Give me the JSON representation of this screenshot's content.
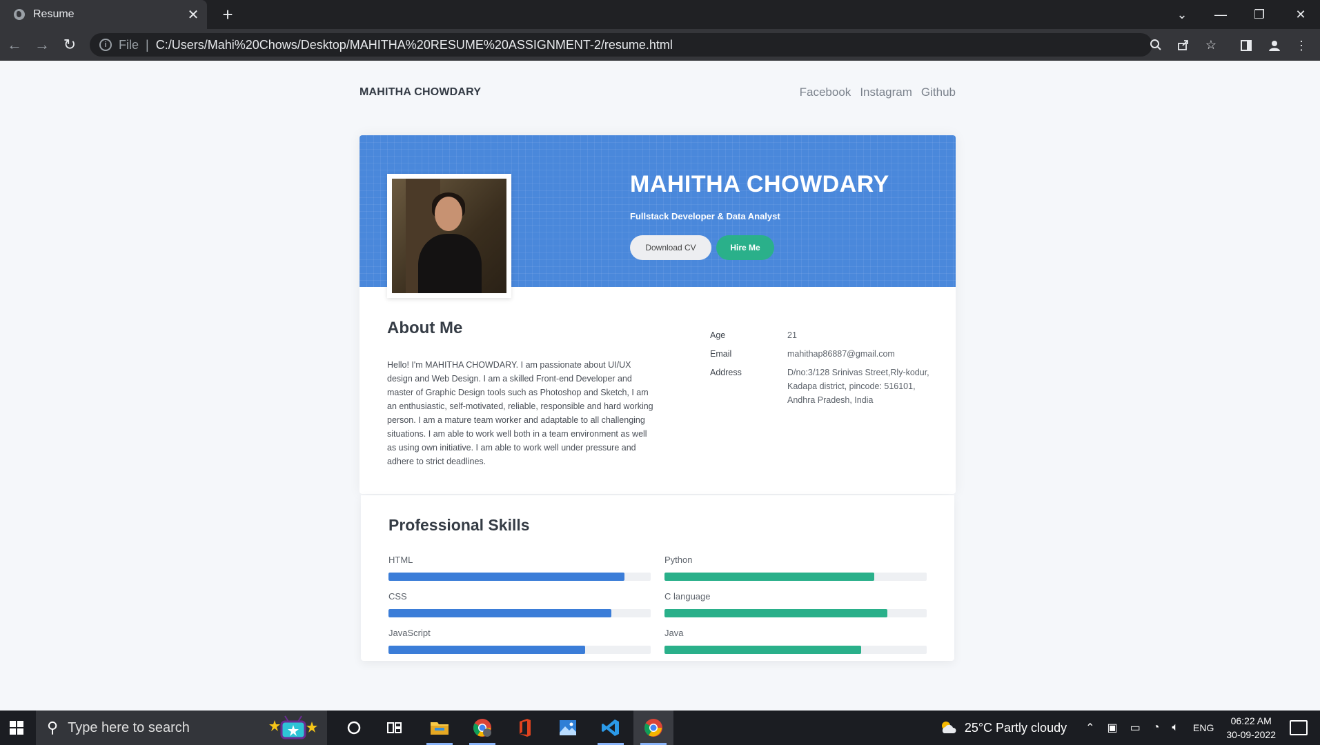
{
  "browser": {
    "tab_title": "Resume",
    "tab_close": "✕",
    "new_tab": "+",
    "address": {
      "scheme": "File",
      "separator": "|",
      "url": "C:/Users/Mahi%20Chows/Desktop/MAHITHA%20RESUME%20ASSIGNMENT-2/resume.html"
    }
  },
  "site": {
    "brand": "MAHITHA CHOWDARY",
    "social": [
      "Facebook",
      "Instagram",
      "Github"
    ]
  },
  "hero": {
    "name": "MAHITHA CHOWDARY",
    "role": "Fullstack Developer & Data Analyst",
    "download_cv": "Download CV",
    "hire_me": "Hire Me"
  },
  "about": {
    "title": "About Me",
    "text": "Hello! I'm MAHITHA CHOWDARY. I am passionate about UI/UX design and Web Design. I am a skilled Front-end Developer and master of Graphic Design tools such as Photoshop and Sketch, I am an enthusiastic, self-motivated, reliable, responsible and hard working person. I am a mature team worker and adaptable to all challenging situations. I am able to work well both in a team environment as well as using own initiative. I am able to work well under pressure and adhere to strict deadlines.",
    "info": [
      {
        "key": "Age",
        "value": "21"
      },
      {
        "key": "Email",
        "value": "mahithap86887@gmail.com"
      },
      {
        "key": "Address",
        "value": "D/no:3/128 Srinivas Street,Rly-kodur, Kadapa district, pincode: 516101, Andhra Pradesh, India"
      }
    ]
  },
  "skills": {
    "title": "Professional Skills",
    "items": [
      {
        "name": "HTML",
        "level": 0.9,
        "color": "#3b7dd8"
      },
      {
        "name": "Python",
        "level": 0.8,
        "color": "#2ab08a"
      },
      {
        "name": "CSS",
        "level": 0.85,
        "color": "#3b7dd8"
      },
      {
        "name": "C language",
        "level": 0.85,
        "color": "#2ab08a"
      },
      {
        "name": "JavaScript",
        "level": 0.75,
        "color": "#3b7dd8"
      },
      {
        "name": "Java",
        "level": 0.75,
        "color": "#2ab08a"
      }
    ]
  },
  "taskbar": {
    "search_placeholder": "Type here to search",
    "weather": "25°C  Partly cloudy",
    "language": "ENG",
    "time": "06:22 AM",
    "date": "30-09-2022"
  },
  "colors": {
    "banner": "#4a88db",
    "accent_green": "#2ab08a",
    "accent_blue": "#3b7dd8"
  }
}
